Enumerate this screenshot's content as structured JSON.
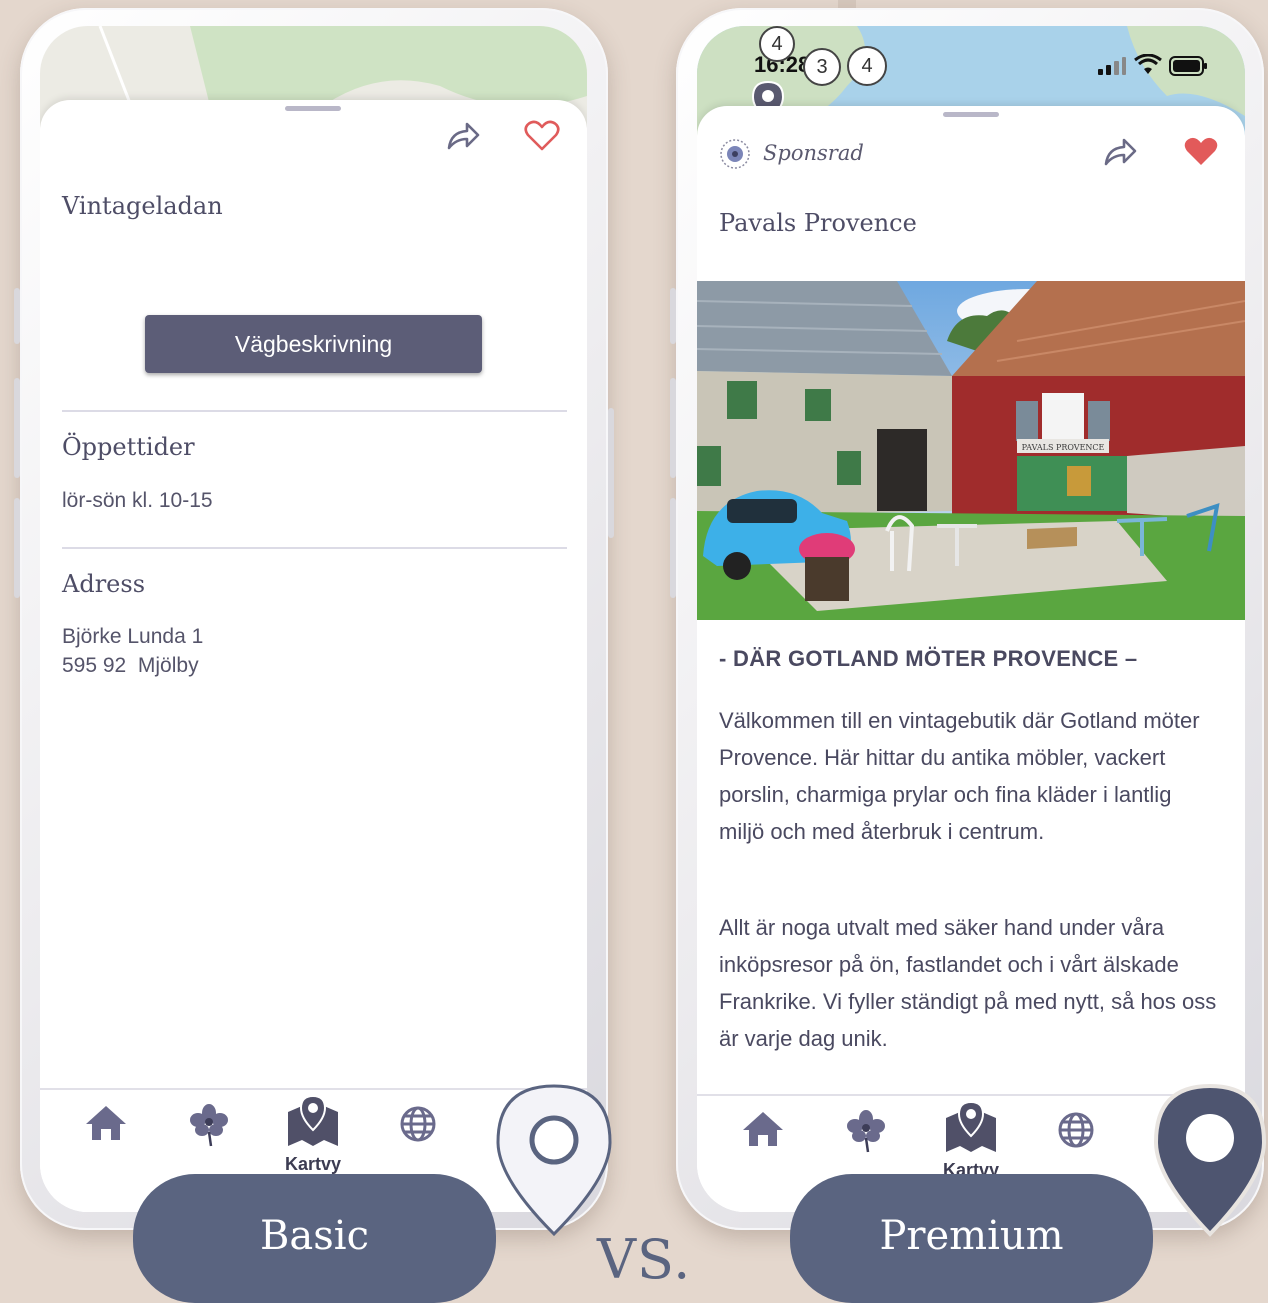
{
  "basic": {
    "place_name": "Vintageladan",
    "directions_label": "Vägbeskrivning",
    "hours_title": "Öppettider",
    "hours_value": "lör-sön kl. 10-15",
    "address_title": "Adress",
    "address_line1": "Björke Lunda 1",
    "address_line2": "595 92  Mjölby",
    "tabbar_active_label": "Kartvy",
    "tier_label": "Basic"
  },
  "premium": {
    "status_time": "16:28",
    "map_clusters": [
      "4",
      "3",
      "4"
    ],
    "sponsored_label": "Sponsrad",
    "place_name": "Pavals Provence",
    "photo_sign": "PAVALS PROVENCE",
    "tagline": "- DÄR GOTLAND MÖTER PROVENCE –",
    "paragraph1": "Välkommen till en vintagebutik där Gotland möter Provence. Här hittar du antika möbler, vackert porslin, charmiga prylar och fina kläder i lantlig miljö och med återbruk i centrum.",
    "paragraph2": "Allt är noga utvalt med säker hand under våra inköpsresor på ön, fastlandet och i vårt älskade Frankrike. Vi fyller ständigt på med nytt, så hos oss är varje dag unik.",
    "tabbar_active_label": "Kartvy",
    "tier_label": "Premium"
  },
  "vs_label": "VS.",
  "icons": [
    "share-icon",
    "heart-outline-icon",
    "heart-filled-icon",
    "home-icon",
    "flower-icon",
    "map-icon",
    "globe-icon",
    "location-pin-icon",
    "signal-icon",
    "wifi-icon",
    "battery-icon"
  ],
  "colors": {
    "background": "#e4d7cd",
    "accent": "#5a6480",
    "button": "#5c5d77",
    "heart": "#e25a5a"
  }
}
